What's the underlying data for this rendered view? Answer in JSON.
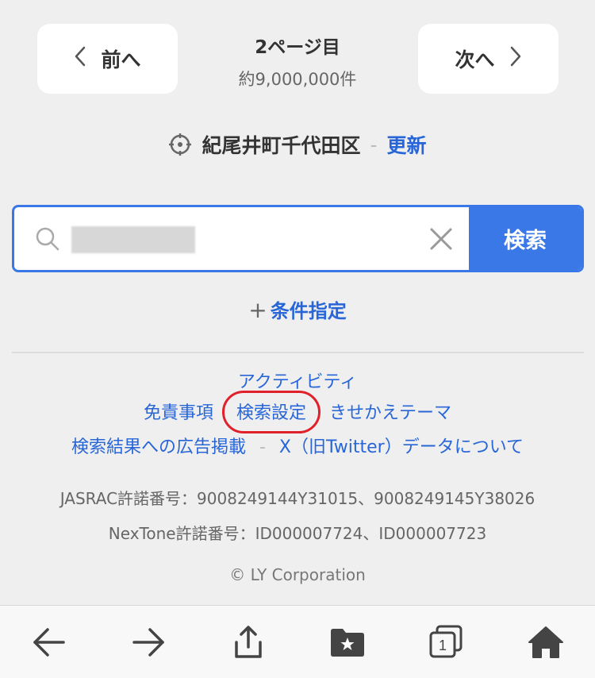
{
  "pager": {
    "prev_label": "前へ",
    "next_label": "次へ",
    "page": "2ページ目",
    "count": "約9,000,000件"
  },
  "location": {
    "name": "紀尾井町千代田区",
    "separator": "-",
    "update_label": "更新"
  },
  "search": {
    "value": "",
    "button_label": "検索"
  },
  "conditions": {
    "plus": "+",
    "label": "条件指定"
  },
  "footer_links": {
    "activity": "アクティビティ",
    "disclaimer": "免責事項",
    "search_settings": "検索設定",
    "theme": "きせかえテーマ",
    "ads": "検索結果への広告掲載",
    "separator": "-",
    "x_data": "X（旧Twitter）データについて"
  },
  "license": {
    "jasrac": "JASRAC許諾番号：9008249144Y31015、9008249145Y38026",
    "nextone": "NexTone許諾番号：ID000007724、ID000007723"
  },
  "copyright": "© LY Corporation",
  "toolbar": {
    "icons": [
      "back-arrow-icon",
      "forward-arrow-icon",
      "share-icon",
      "bookmark-folder-icon",
      "tabs-icon",
      "home-icon"
    ],
    "tab_count": "1"
  },
  "colors": {
    "link": "#2866d8",
    "accent": "#3b78e7",
    "highlight": "#e0202a",
    "background": "#efeff0"
  }
}
